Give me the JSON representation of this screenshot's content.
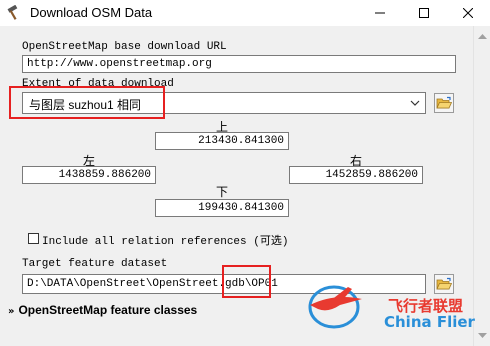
{
  "window": {
    "title": "Download OSM Data"
  },
  "form": {
    "base_url_label": "OpenStreetMap base download URL",
    "base_url_value": "http://www.openstreetmap.org",
    "extent_label": "Extent of data download",
    "extent_selected": "与图层 suzhou1 相同",
    "extent": {
      "top_label": "上",
      "top_value": "213430.841300",
      "left_label": "左",
      "left_value": "1438859.886200",
      "right_label": "右",
      "right_value": "1452859.886200",
      "bottom_label": "下",
      "bottom_value": "199430.841300"
    },
    "include_relations_label": "Include all relation references (可选)",
    "include_relations_checked": false,
    "target_label": "Target feature dataset",
    "target_value": "D:\\DATA\\OpenStreet\\OpenStreet.gdb\\OP01",
    "feature_classes_label": "OpenStreetMap feature classes"
  },
  "watermark": {
    "cn_text": "飞行者联盟",
    "en_text": "China Flier"
  },
  "colors": {
    "highlight_box": "#e62020",
    "watermark_red": "#e83a30",
    "watermark_blue": "#2a8fd8"
  }
}
